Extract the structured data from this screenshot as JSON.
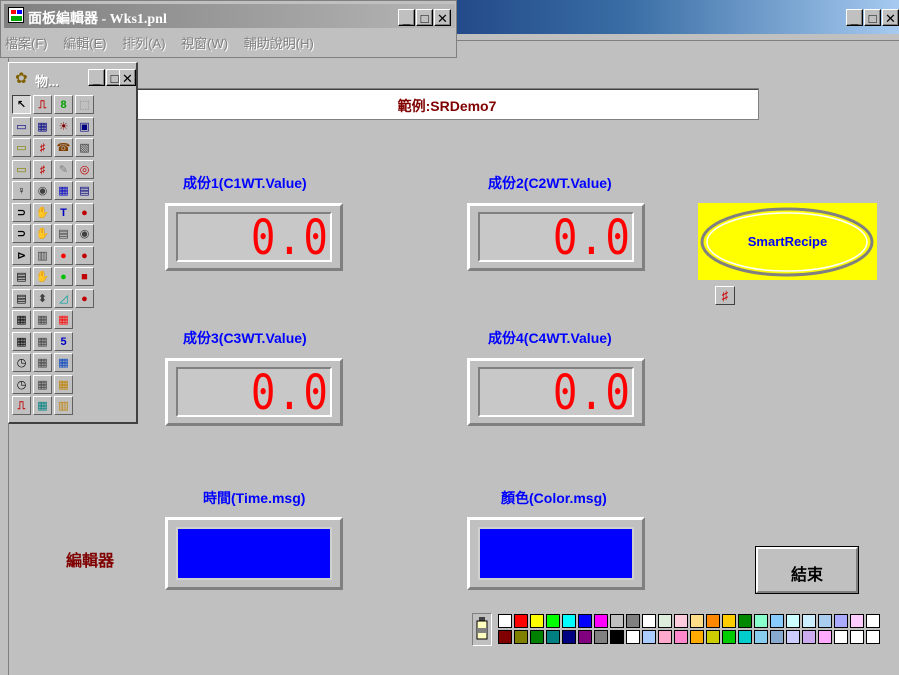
{
  "main_window": {
    "title": ""
  },
  "editor_window": {
    "title": "面板編輯器 - Wks1.pnl",
    "menu": [
      "檔案(F)",
      "編輯(E)",
      "排列(A)",
      "視窗(W)",
      "輔助說明(H)"
    ]
  },
  "toolbox": {
    "title": "物..."
  },
  "canvas": {
    "example_label": "範例:SRDemo7",
    "components": [
      {
        "caption": "成份1(C1WT.Value)",
        "value": "0.0"
      },
      {
        "caption": "成份2(C2WT.Value)",
        "value": "0.0"
      },
      {
        "caption": "成份3(C3WT.Value)",
        "value": "0.0"
      },
      {
        "caption": "成份4(C4WT.Value)",
        "value": "0.0"
      }
    ],
    "time_caption": "時間(Time.msg)",
    "color_caption": "顏色(Color.msg)",
    "editor_label": "編輯器",
    "smart_recipe_label": "SmartRecipe",
    "end_button_label": "結束"
  },
  "colors": {
    "display_digits": "#ff0000",
    "caption_text": "#0000ff",
    "editor_label": "#800000",
    "smart_recipe_bg": "#ffff00",
    "msg_box_fill": "#0000ff",
    "palette_top": [
      "#ffffff",
      "#ff0000",
      "#ffff00",
      "#00ff00",
      "#00ffff",
      "#0000ff",
      "#ff00ff",
      "#c0c0c0",
      "#808080",
      "#ffffff",
      "#ddeedd",
      "#ffccdd",
      "#ffdd88",
      "#ff8800",
      "#ffcc00",
      "#008800",
      "#88ffcc",
      "#88ccff",
      "#ccffff",
      "#cceeff",
      "#aaccee",
      "#aaaaff",
      "#ffccff",
      "#ffffff"
    ],
    "palette_bottom": [
      "#800000",
      "#808000",
      "#008000",
      "#008080",
      "#000080",
      "#800080",
      "#808080",
      "#000000",
      "#ffffff",
      "#aaccff",
      "#ffaacc",
      "#ff88cc",
      "#ffaa00",
      "#cccc00",
      "#00cc00",
      "#00cccc",
      "#88ccee",
      "#88aacc",
      "#ccccff",
      "#ccaaee",
      "#ffaaff",
      "#ffffff",
      "#ffffff",
      "#ffffff"
    ]
  }
}
